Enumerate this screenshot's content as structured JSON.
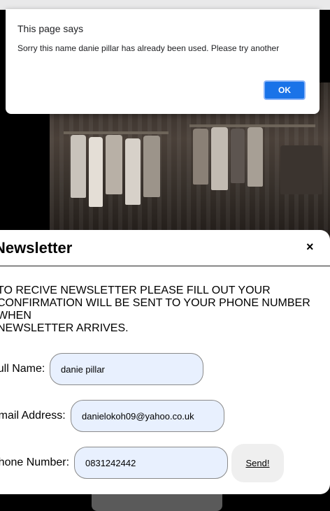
{
  "alert": {
    "title": "This page says",
    "message": "Sorry this name danie pillar has already been used. Please try another",
    "ok_label": "OK"
  },
  "newsletter": {
    "title": "Newsletter",
    "close_label": "×",
    "description_lines": [
      "TO RECIVE NEWSLETTER PLEASE FILL OUT YOUR",
      "CONFIRMATION WILL BE SENT TO YOUR PHONE NUMBER",
      "WHEN",
      "NEWSLETTER ARRIVES."
    ],
    "fields": {
      "full_name": {
        "label": "Full Name:",
        "value": "danie pillar"
      },
      "email": {
        "label": "Email Address:",
        "value": "danielokoh09@yahoo.co.uk"
      },
      "phone": {
        "label": "Phone Number:",
        "value": "0831242442"
      }
    },
    "send_label": "Send!"
  },
  "colors": {
    "ok_button": "#1a73e8",
    "input_background": "#e8f0fe",
    "send_button_background": "#efefef"
  }
}
